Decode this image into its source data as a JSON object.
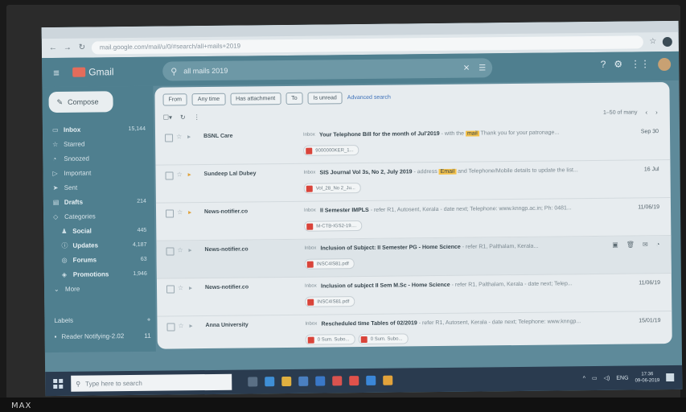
{
  "overlay_text": "MAX",
  "browser": {
    "url": "mail.google.com/mail/u/0/#search/all+mails+2019"
  },
  "gmail": {
    "logo_text": "Gmail",
    "search_value": "all mails 2019",
    "compose_label": "Compose",
    "sidebar": [
      {
        "icon": "inbox-icon",
        "glyph": "▭",
        "label": "Inbox",
        "count": "15,144",
        "bold": true
      },
      {
        "icon": "star-icon",
        "glyph": "☆",
        "label": "Starred",
        "count": ""
      },
      {
        "icon": "clock-icon",
        "glyph": "◔",
        "label": "Snoozed",
        "count": ""
      },
      {
        "icon": "important-icon",
        "glyph": "▷",
        "label": "Important",
        "count": ""
      },
      {
        "icon": "send-icon",
        "glyph": "➤",
        "label": "Sent",
        "count": ""
      },
      {
        "icon": "draft-icon",
        "glyph": "▤",
        "label": "Drafts",
        "count": "214",
        "bold": true
      },
      {
        "icon": "tag-icon",
        "glyph": "◇",
        "label": "Categories",
        "count": ""
      },
      {
        "icon": "people-icon",
        "glyph": "♟",
        "label": "Social",
        "count": "445",
        "sub": true,
        "bold": true
      },
      {
        "icon": "info-icon",
        "glyph": "ⓘ",
        "label": "Updates",
        "count": "4,187",
        "sub": true,
        "bold": true
      },
      {
        "icon": "forum-icon",
        "glyph": "◎",
        "label": "Forums",
        "count": "63",
        "sub": true,
        "bold": true
      },
      {
        "icon": "promo-tag-icon",
        "glyph": "◈",
        "label": "Promotions",
        "count": "1,946",
        "sub": true,
        "bold": true
      },
      {
        "icon": "chevron-down-icon",
        "glyph": "⌄",
        "label": "More",
        "count": ""
      }
    ],
    "labels_header": "Labels",
    "labels_add": "+",
    "label_items": [
      {
        "label": "Reader Notifying-2.02",
        "count": "11"
      }
    ],
    "chips": [
      "From",
      "Any time",
      "Has attachment",
      "To",
      "Is unread"
    ],
    "advanced_search": "Advanced search",
    "pager": "1–50 of many",
    "rows": [
      {
        "sender": "BSNL Care",
        "tag": "Inbox",
        "subject": "Your Telephone Bill for the month of Jul'2019",
        "snippet_pre": " - with the ",
        "highlight": "mail",
        "snippet_post": " Thank you for your patronage...",
        "date": "Sep 30",
        "attachments": [
          "9000000KER_1..."
        ],
        "important": false
      },
      {
        "sender": "Sundeep Lal Dubey",
        "tag": "Inbox",
        "subject": "SIS Journal Vol 3s, No 2, July 2019",
        "snippet_pre": " - address ",
        "highlight": "Email",
        "snippet_post": " and Telephone/Mobile details to update the list...",
        "date": "16 Jul",
        "attachments": [
          "Vol_28_No 2_Ju..."
        ],
        "important": true
      },
      {
        "sender": "News-notifier.co",
        "tag": "Inbox",
        "subject": "II Semester IMPLS",
        "snippet_pre": " - refer R1, Autosent, Kerala - date next; Telephone: www.knngp.ac.in; Ph: 0481...",
        "highlight": "",
        "snippet_post": "",
        "date": "11/06/19",
        "attachments": [
          "M-CTB-IGS2-19...."
        ],
        "important": true
      },
      {
        "sender": "News-notifier.co",
        "tag": "Inbox",
        "subject": "Inclusion of Subject: II Semester PG - Home Science",
        "snippet_pre": " - refer R1, Palthalam, Kerala...",
        "highlight": "",
        "snippet_post": "",
        "date": "",
        "attachments": [
          "INSC4IS81.pdf"
        ],
        "important": false,
        "hovered": true
      },
      {
        "sender": "News-notifier.co",
        "tag": "Inbox",
        "subject": "Inclusion of subject II Sem M.Sc - Home Science",
        "snippet_pre": " - refer R1, Palthalam, Kerala - date next; Telep...",
        "highlight": "",
        "snippet_post": "",
        "date": "11/06/19",
        "attachments": [
          "INSC4IS81.pdf"
        ],
        "important": false
      },
      {
        "sender": "Anna University",
        "tag": "Inbox",
        "subject": "Rescheduled time Tables of 02/2019",
        "snippet_pre": " - refer R1, Autosent, Kerala - date next; Telephone: www.knngp...",
        "highlight": "",
        "snippet_post": "",
        "date": "15/01/19",
        "attachments": [
          "0 Sum. Subo...",
          "0 Sum. Subo..."
        ],
        "important": false
      }
    ]
  },
  "taskbar": {
    "search_placeholder": "Type here to search",
    "apps": [
      {
        "name": "task-view-icon",
        "color": "#5a6f85"
      },
      {
        "name": "edge-icon",
        "color": "#3f8fd6"
      },
      {
        "name": "file-explorer-icon",
        "color": "#e0b040"
      },
      {
        "name": "store-icon",
        "color": "#4a7fc0"
      },
      {
        "name": "mail-app-icon",
        "color": "#3a78c8"
      },
      {
        "name": "chrome-icon",
        "color": "#d9534f"
      },
      {
        "name": "shield-app-icon",
        "color": "#e0524b"
      },
      {
        "name": "bell-app-icon",
        "color": "#3b87d8"
      },
      {
        "name": "chrome-2-icon",
        "color": "#e2a33b"
      }
    ],
    "lang": "ENG",
    "time": "17:36",
    "date": "09-06-2019"
  }
}
